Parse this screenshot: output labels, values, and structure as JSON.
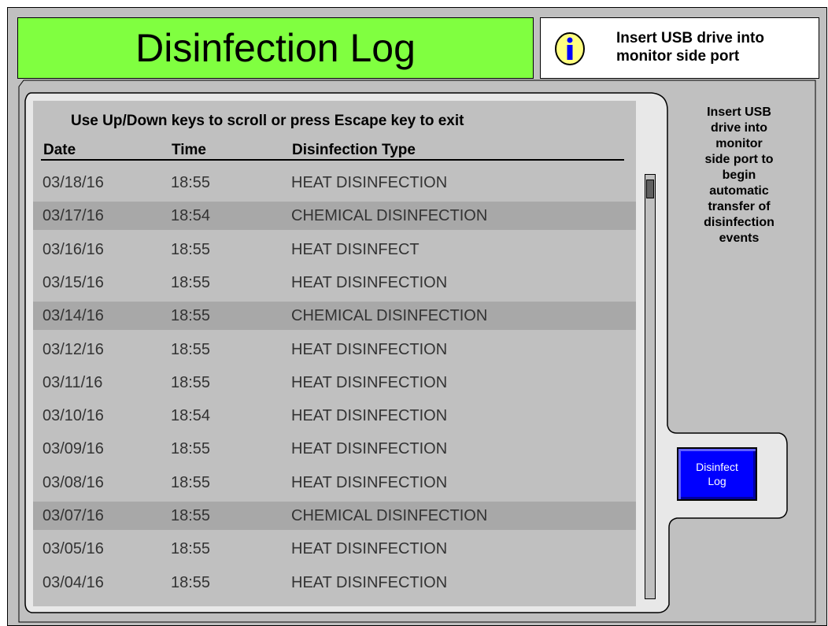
{
  "header": {
    "title": "Disinfection Log",
    "info_text": "Insert USB drive into monitor side port"
  },
  "log": {
    "instructions": "Use Up/Down keys to scroll or press Escape key to exit",
    "columns": [
      "Date",
      "Time",
      "Disinfection Type"
    ],
    "rows": [
      {
        "date": "03/18/16",
        "time": "18:55",
        "type": "HEAT DISINFECTION",
        "highlight": false
      },
      {
        "date": "03/17/16",
        "time": "18:54",
        "type": "CHEMICAL  DISINFECTION",
        "highlight": true
      },
      {
        "date": "03/16/16",
        "time": "18:55",
        "type": "HEAT DISINFECT",
        "highlight": false
      },
      {
        "date": "03/15/16",
        "time": "18:55",
        "type": "HEAT DISINFECTION",
        "highlight": false
      },
      {
        "date": "03/14/16",
        "time": "18:55",
        "type": "CHEMICAL  DISINFECTION",
        "highlight": true
      },
      {
        "date": "03/12/16",
        "time": "18:55",
        "type": "HEAT DISINFECTION",
        "highlight": false
      },
      {
        "date": "03/11/16",
        "time": "18:55",
        "type": "HEAT DISINFECTION",
        "highlight": false
      },
      {
        "date": "03/10/16",
        "time": "18:54",
        "type": "HEAT DISINFECTION",
        "highlight": false
      },
      {
        "date": "03/09/16",
        "time": "18:55",
        "type": "HEAT DISINFECTION",
        "highlight": false
      },
      {
        "date": "03/08/16",
        "time": "18:55",
        "type": "HEAT DISINFECTION",
        "highlight": false
      },
      {
        "date": "03/07/16",
        "time": "18:55",
        "type": "CHEMICAL  DISINFECTION",
        "highlight": true
      },
      {
        "date": "03/05/16",
        "time": "18:55",
        "type": "HEAT DISINFECTION",
        "highlight": false
      },
      {
        "date": "03/04/16",
        "time": "18:55",
        "type": "HEAT DISINFECTION",
        "highlight": false
      }
    ]
  },
  "side_panel": {
    "text_lines": [
      "Insert USB",
      "drive into",
      "monitor",
      "side port to",
      "begin",
      "automatic",
      "transfer of",
      "disinfection",
      "events"
    ],
    "button_lines": [
      "Disinfect",
      "Log"
    ]
  },
  "colors": {
    "title_bg": "#80ff40",
    "panel_bg": "#c0c0c0",
    "row_highlight": "#a8a8a8",
    "button_bg": "#0000ff",
    "info_icon": "#ffff80"
  },
  "icons": {
    "info": "info-icon"
  }
}
